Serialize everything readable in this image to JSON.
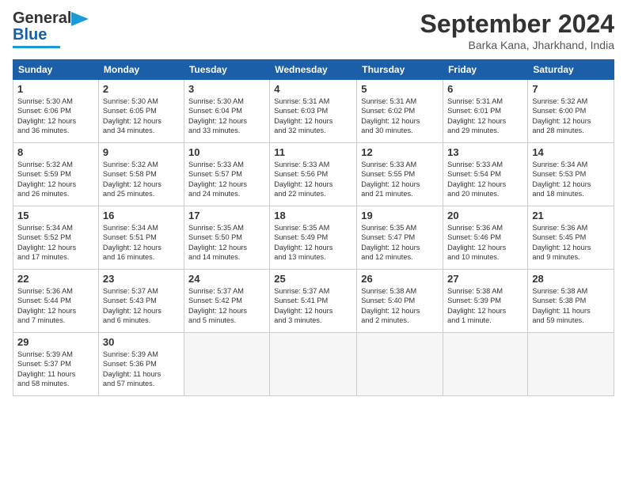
{
  "header": {
    "logo_line1": "General",
    "logo_line2": "Blue",
    "month_title": "September 2024",
    "location": "Barka Kana, Jharkhand, India"
  },
  "days_of_week": [
    "Sunday",
    "Monday",
    "Tuesday",
    "Wednesday",
    "Thursday",
    "Friday",
    "Saturday"
  ],
  "weeks": [
    [
      {
        "day": "1",
        "info": "Sunrise: 5:30 AM\nSunset: 6:06 PM\nDaylight: 12 hours\nand 36 minutes."
      },
      {
        "day": "2",
        "info": "Sunrise: 5:30 AM\nSunset: 6:05 PM\nDaylight: 12 hours\nand 34 minutes."
      },
      {
        "day": "3",
        "info": "Sunrise: 5:30 AM\nSunset: 6:04 PM\nDaylight: 12 hours\nand 33 minutes."
      },
      {
        "day": "4",
        "info": "Sunrise: 5:31 AM\nSunset: 6:03 PM\nDaylight: 12 hours\nand 32 minutes."
      },
      {
        "day": "5",
        "info": "Sunrise: 5:31 AM\nSunset: 6:02 PM\nDaylight: 12 hours\nand 30 minutes."
      },
      {
        "day": "6",
        "info": "Sunrise: 5:31 AM\nSunset: 6:01 PM\nDaylight: 12 hours\nand 29 minutes."
      },
      {
        "day": "7",
        "info": "Sunrise: 5:32 AM\nSunset: 6:00 PM\nDaylight: 12 hours\nand 28 minutes."
      }
    ],
    [
      {
        "day": "8",
        "info": "Sunrise: 5:32 AM\nSunset: 5:59 PM\nDaylight: 12 hours\nand 26 minutes."
      },
      {
        "day": "9",
        "info": "Sunrise: 5:32 AM\nSunset: 5:58 PM\nDaylight: 12 hours\nand 25 minutes."
      },
      {
        "day": "10",
        "info": "Sunrise: 5:33 AM\nSunset: 5:57 PM\nDaylight: 12 hours\nand 24 minutes."
      },
      {
        "day": "11",
        "info": "Sunrise: 5:33 AM\nSunset: 5:56 PM\nDaylight: 12 hours\nand 22 minutes."
      },
      {
        "day": "12",
        "info": "Sunrise: 5:33 AM\nSunset: 5:55 PM\nDaylight: 12 hours\nand 21 minutes."
      },
      {
        "day": "13",
        "info": "Sunrise: 5:33 AM\nSunset: 5:54 PM\nDaylight: 12 hours\nand 20 minutes."
      },
      {
        "day": "14",
        "info": "Sunrise: 5:34 AM\nSunset: 5:53 PM\nDaylight: 12 hours\nand 18 minutes."
      }
    ],
    [
      {
        "day": "15",
        "info": "Sunrise: 5:34 AM\nSunset: 5:52 PM\nDaylight: 12 hours\nand 17 minutes."
      },
      {
        "day": "16",
        "info": "Sunrise: 5:34 AM\nSunset: 5:51 PM\nDaylight: 12 hours\nand 16 minutes."
      },
      {
        "day": "17",
        "info": "Sunrise: 5:35 AM\nSunset: 5:50 PM\nDaylight: 12 hours\nand 14 minutes."
      },
      {
        "day": "18",
        "info": "Sunrise: 5:35 AM\nSunset: 5:49 PM\nDaylight: 12 hours\nand 13 minutes."
      },
      {
        "day": "19",
        "info": "Sunrise: 5:35 AM\nSunset: 5:47 PM\nDaylight: 12 hours\nand 12 minutes."
      },
      {
        "day": "20",
        "info": "Sunrise: 5:36 AM\nSunset: 5:46 PM\nDaylight: 12 hours\nand 10 minutes."
      },
      {
        "day": "21",
        "info": "Sunrise: 5:36 AM\nSunset: 5:45 PM\nDaylight: 12 hours\nand 9 minutes."
      }
    ],
    [
      {
        "day": "22",
        "info": "Sunrise: 5:36 AM\nSunset: 5:44 PM\nDaylight: 12 hours\nand 7 minutes."
      },
      {
        "day": "23",
        "info": "Sunrise: 5:37 AM\nSunset: 5:43 PM\nDaylight: 12 hours\nand 6 minutes."
      },
      {
        "day": "24",
        "info": "Sunrise: 5:37 AM\nSunset: 5:42 PM\nDaylight: 12 hours\nand 5 minutes."
      },
      {
        "day": "25",
        "info": "Sunrise: 5:37 AM\nSunset: 5:41 PM\nDaylight: 12 hours\nand 3 minutes."
      },
      {
        "day": "26",
        "info": "Sunrise: 5:38 AM\nSunset: 5:40 PM\nDaylight: 12 hours\nand 2 minutes."
      },
      {
        "day": "27",
        "info": "Sunrise: 5:38 AM\nSunset: 5:39 PM\nDaylight: 12 hours\nand 1 minute."
      },
      {
        "day": "28",
        "info": "Sunrise: 5:38 AM\nSunset: 5:38 PM\nDaylight: 11 hours\nand 59 minutes."
      }
    ],
    [
      {
        "day": "29",
        "info": "Sunrise: 5:39 AM\nSunset: 5:37 PM\nDaylight: 11 hours\nand 58 minutes."
      },
      {
        "day": "30",
        "info": "Sunrise: 5:39 AM\nSunset: 5:36 PM\nDaylight: 11 hours\nand 57 minutes."
      },
      {
        "day": "",
        "info": ""
      },
      {
        "day": "",
        "info": ""
      },
      {
        "day": "",
        "info": ""
      },
      {
        "day": "",
        "info": ""
      },
      {
        "day": "",
        "info": ""
      }
    ]
  ]
}
